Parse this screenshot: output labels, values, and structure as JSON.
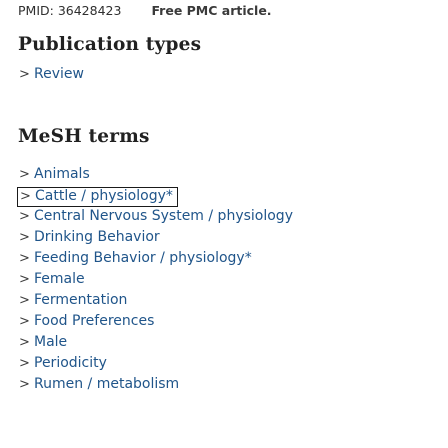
{
  "citation": {
    "pmid": "PMID: 36428423",
    "free_pmc": "Free PMC article."
  },
  "publication_types": {
    "heading": "Publication types",
    "items": [
      {
        "label": "Review"
      }
    ]
  },
  "mesh_terms": {
    "heading": "MeSH terms",
    "items": [
      {
        "label": "Animals"
      },
      {
        "label": "Cattle / physiology*"
      },
      {
        "label": "Central Nervous System / physiology"
      },
      {
        "label": "Drinking Behavior"
      },
      {
        "label": "Feeding Behavior / physiology*"
      },
      {
        "label": "Female"
      },
      {
        "label": "Fermentation"
      },
      {
        "label": "Food Preferences"
      },
      {
        "label": "Male"
      },
      {
        "label": "Periodicity"
      },
      {
        "label": "Rumen / metabolism"
      }
    ],
    "focused_index": 1
  },
  "icons": {
    "expand": "chevron-right-icon"
  },
  "colors": {
    "link": "#20558a",
    "heading": "#212121"
  }
}
